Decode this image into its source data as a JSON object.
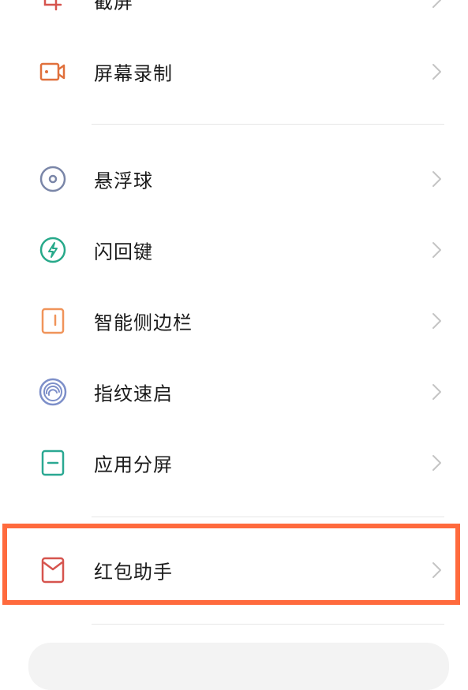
{
  "items": [
    {
      "label": "截屏",
      "icon": "screenshot-icon"
    },
    {
      "label": "屏幕录制",
      "icon": "screen-record-icon"
    },
    {
      "label": "悬浮球",
      "icon": "floating-ball-icon"
    },
    {
      "label": "闪回键",
      "icon": "flashback-key-icon"
    },
    {
      "label": "智能侧边栏",
      "icon": "smart-sidebar-icon"
    },
    {
      "label": "指纹速启",
      "icon": "fingerprint-icon"
    },
    {
      "label": "应用分屏",
      "icon": "split-screen-icon"
    },
    {
      "label": "红包助手",
      "icon": "red-envelope-icon"
    }
  ],
  "colors": {
    "highlight": "#ff6a3d",
    "screen_record": "#e0703c",
    "floating_ball": "#7a86a8",
    "flashback": "#27a98a",
    "sidebar": "#f0945a",
    "fingerprint": "#7d8fc9",
    "split": "#2aa892",
    "red_envelope": "#d6544e"
  }
}
